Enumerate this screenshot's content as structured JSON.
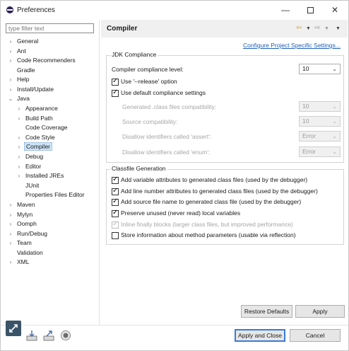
{
  "window": {
    "title": "Preferences",
    "minimize_glyph": "—",
    "close_glyph": "✕"
  },
  "filter": {
    "placeholder": "type filter text"
  },
  "tree": {
    "general": "General",
    "ant": "Ant",
    "code_recommenders": "Code Recommenders",
    "gradle": "Gradle",
    "help": "Help",
    "install_update": "Install/Update",
    "java": "Java",
    "appearance": "Appearance",
    "build_path": "Build Path",
    "code_coverage": "Code Coverage",
    "code_style": "Code Style",
    "compiler": "Compiler",
    "debug": "Debug",
    "editor": "Editor",
    "installed_jres": "Installed JREs",
    "junit": "JUnit",
    "properties_files_editor": "Properties Files Editor",
    "maven": "Maven",
    "mylyn": "Mylyn",
    "oomph": "Oomph",
    "run_debug": "Run/Debug",
    "team": "Team",
    "validation": "Validation",
    "xml": "XML"
  },
  "page": {
    "title": "Compiler",
    "config_link": "Configure Project Specific Settings...",
    "jdk_group": "JDK Compliance",
    "compliance_label": "Compiler compliance level:",
    "compliance_value": "10",
    "use_release": "Use '--release' option",
    "use_default": "Use default compliance settings",
    "generated_label": "Generated .class files compatibility:",
    "generated_value": "10",
    "source_label": "Source compatibility:",
    "source_value": "10",
    "assert_label": "Disallow identifiers called 'assert':",
    "assert_value": "Error",
    "enum_label": "Disallow identifiers called 'enum':",
    "enum_value": "Error",
    "classfile_group": "Classfile Generation",
    "cf_variable": "Add variable attributes to generated class files (used by the debugger)",
    "cf_line": "Add line number attributes to generated class files (used by the debugger)",
    "cf_source": "Add source file name to generated class file (used by the debugger)",
    "cf_preserve": "Preserve unused (never read) local variables",
    "cf_inline": "Inline finally blocks (larger class files, but improved performance)",
    "cf_params": "Store information about method parameters (usable via reflection)"
  },
  "checkbox_state": {
    "use_release": true,
    "use_default": true,
    "cf_variable": true,
    "cf_line": true,
    "cf_source": true,
    "cf_preserve": true,
    "cf_inline": true,
    "cf_params": false
  },
  "buttons": {
    "restore_defaults": "Restore Defaults",
    "apply": "Apply",
    "apply_and_close": "Apply and Close",
    "cancel": "Cancel"
  },
  "icons": [
    "help-icon",
    "import-icon",
    "export-icon",
    "record-icon"
  ]
}
